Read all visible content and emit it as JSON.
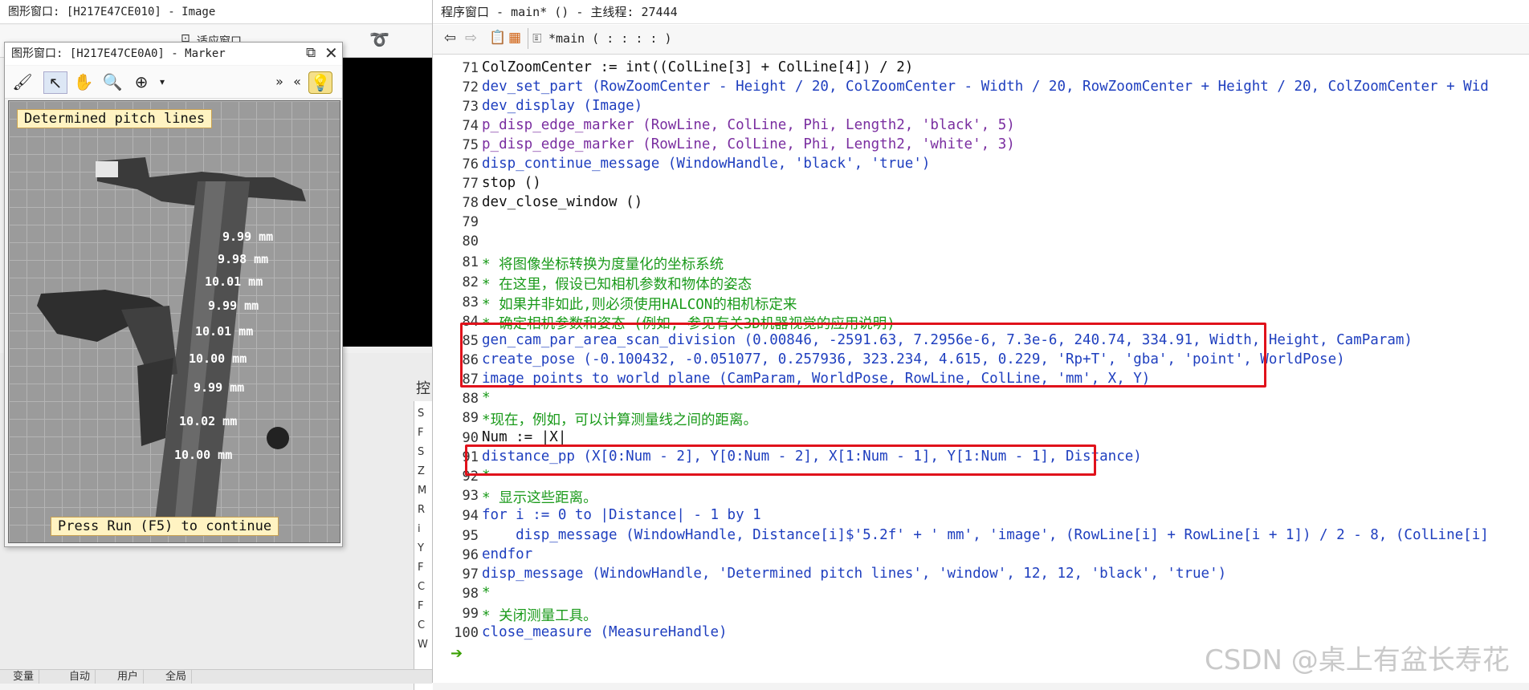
{
  "image_window": {
    "title": "图形窗口: [H217E47CE010] - Image",
    "toolbar_label": "适应窗口",
    "control_label": "控",
    "control_chars": [
      "S",
      "F",
      "S",
      "Z",
      "M",
      "R",
      "i",
      "Y",
      "F",
      "C",
      "F",
      "C",
      "W"
    ],
    "bottom_tabs": [
      "变量",
      "自动",
      "用户",
      "全局"
    ]
  },
  "marker_window": {
    "title": "图形窗口: [H217E47CE0A0] - Marker",
    "header_text": "Determined pitch lines",
    "footer_text": "Press Run (F5) to continue",
    "measurements": [
      "9.99 mm",
      "9.98 mm",
      "10.01 mm",
      "9.99 mm",
      "10.01 mm",
      "10.00 mm",
      "9.99 mm",
      "10.02 mm",
      "10.00 mm"
    ]
  },
  "program_window": {
    "title": "程序窗口 - main* () - 主线程: 27444",
    "proc_label": "*main ( : : : : )",
    "lines": [
      {
        "n": "71",
        "text": "ColZoomCenter := int((ColLine[3] + ColLine[4]) / 2)"
      },
      {
        "n": "72",
        "text": "dev_set_part (RowZoomCenter - Height / 20, ColZoomCenter - Width / 20, RowZoomCenter + Height / 20, ColZoomCenter + Wid"
      },
      {
        "n": "73",
        "text": "dev_display (Image)"
      },
      {
        "n": "74",
        "text": "p_disp_edge_marker (RowLine, ColLine, Phi, Length2, 'black', 5)"
      },
      {
        "n": "75",
        "text": "p_disp_edge_marker (RowLine, ColLine, Phi, Length2, 'white', 3)"
      },
      {
        "n": "76",
        "text": "disp_continue_message (WindowHandle, 'black', 'true')"
      },
      {
        "n": "77",
        "text": "stop ()"
      },
      {
        "n": "78",
        "text": "dev_close_window ()"
      },
      {
        "n": "79",
        "text": ""
      },
      {
        "n": "80",
        "text": ""
      },
      {
        "n": "81",
        "text": "* 将图像坐标转换为度量化的坐标系统"
      },
      {
        "n": "82",
        "text": "* 在这里，假设已知相机参数和物体的姿态"
      },
      {
        "n": "83",
        "text": "* 如果并非如此,则必须使用HALCON的相机标定来"
      },
      {
        "n": "84",
        "text": "* 确定相机参数和姿态 (例如, 参见有关3D机器视觉的应用说明)"
      },
      {
        "n": "85",
        "text": "gen_cam_par_area_scan_division (0.00846, -2591.63, 7.2956e-6, 7.3e-6, 240.74, 334.91, Width, Height, CamParam)"
      },
      {
        "n": "86",
        "text": "create_pose (-0.100432, -0.051077, 0.257936, 323.234, 4.615, 0.229, 'Rp+T', 'gba', 'point', WorldPose)"
      },
      {
        "n": "87",
        "text": "image_points_to_world_plane (CamParam, WorldPose, RowLine, ColLine, 'mm', X, Y)"
      },
      {
        "n": "88",
        "text": "*"
      },
      {
        "n": "89",
        "text": "*现在，例如，可以计算测量线之间的距离。"
      },
      {
        "n": "90",
        "text": "Num := |X|"
      },
      {
        "n": "91",
        "text": "distance_pp (X[0:Num - 2], Y[0:Num - 2], X[1:Num - 1], Y[1:Num - 1], Distance)"
      },
      {
        "n": "92",
        "text": "*"
      },
      {
        "n": "93",
        "text": "* 显示这些距离。"
      },
      {
        "n": "94",
        "text": "for i := 0 to |Distance| - 1 by 1"
      },
      {
        "n": "95",
        "text": "    disp_message (WindowHandle, Distance[i]$'5.2f' + ' mm', 'image', (RowLine[i] + RowLine[i + 1]) / 2 - 8, (ColLine[i]"
      },
      {
        "n": "96",
        "text": "endfor"
      },
      {
        "n": "97",
        "text": "disp_message (WindowHandle, 'Determined pitch lines', 'window', 12, 12, 'black', 'true')"
      },
      {
        "n": "98",
        "text": "*"
      },
      {
        "n": "99",
        "text": "* 关闭测量工具。"
      },
      {
        "n": "100",
        "text": "close_measure (MeasureHandle)"
      }
    ]
  },
  "watermark": "CSDN @桌上有盆长寿花",
  "colors": {
    "highlight_box": "#e0121b",
    "comment": "#1a9a1a",
    "procedure": "#1f3fbf",
    "current_line_arrow": "#3aa000"
  }
}
